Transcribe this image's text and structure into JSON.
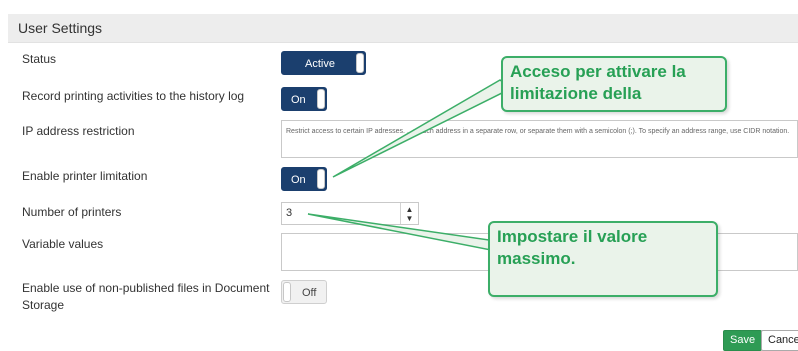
{
  "panel": {
    "title": "User Settings"
  },
  "settings": {
    "status": {
      "label": "Status",
      "toggle": "Active"
    },
    "record": {
      "label": "Record printing activities to the history log",
      "toggle": "On"
    },
    "ip": {
      "label": "IP address restriction",
      "text": "Restrict access to certain IP adresses. ...a each address in a separate row, or separate them with a semicolon (;). To specify an address range, use CIDR notation."
    },
    "printer_limitation": {
      "label": "Enable printer limitation",
      "toggle": "On"
    },
    "num_printers": {
      "label": "Number of printers",
      "value": "3"
    },
    "variable_values": {
      "label": "Variable values",
      "text": ""
    },
    "nonpublished": {
      "label": "Enable use of non-published files in Document Storage",
      "toggle": "Off"
    }
  },
  "buttons": {
    "save": "Save",
    "cancel": "Cancel"
  },
  "callouts": {
    "top": "Acceso per attivare la limitazione della",
    "bottom": "Impostare il valore massimo."
  },
  "colors": {
    "toggle_on": "#1b3f6e",
    "save": "#2e9b54",
    "callout_border": "#3cae68",
    "callout_text": "#27a055",
    "callout_bg": "#eaf3ea"
  },
  "icons": {
    "spinner": "up-down-arrows-icon",
    "resize": "resize-grip-icon"
  }
}
